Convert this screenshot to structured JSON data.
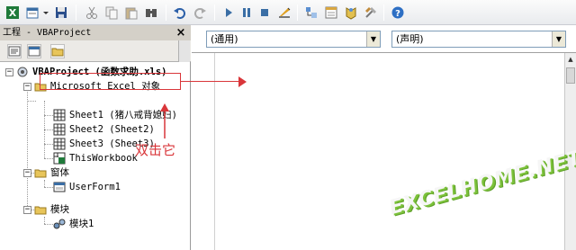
{
  "toolbar": {
    "icons": [
      "excel-icon",
      "insert-userform-icon",
      "save-icon",
      "cut-icon",
      "copy-icon",
      "paste-icon",
      "find-icon",
      "undo-icon",
      "redo-icon",
      "run-icon",
      "break-icon",
      "reset-icon",
      "design-mode-icon",
      "project-explorer-icon",
      "properties-window-icon",
      "object-browser-icon",
      "toolbox-icon",
      "help-icon"
    ]
  },
  "project": {
    "title": "工程 - VBAProject",
    "close": "×",
    "tree": {
      "root": "VBAProject (函数求助.xls)",
      "excel_objects": "Microsoft Excel 对象",
      "sheet1": "Sheet1 (猪八戒背媳妇)",
      "sheet2": "Sheet2 (Sheet2)",
      "sheet3": "Sheet3 (Sheet3)",
      "workbook": "ThisWorkbook",
      "forms": "窗体",
      "userform1": "UserForm1",
      "modules": "模块",
      "module1": "模块1"
    },
    "annotation": "双击它"
  },
  "code": {
    "object_combo": "(通用)",
    "proc_combo": "(声明)"
  },
  "watermark": "EXCELHOME.NET",
  "colors": {
    "annotation_red": "#d9363a",
    "watermark_green": "#7cc23a"
  }
}
